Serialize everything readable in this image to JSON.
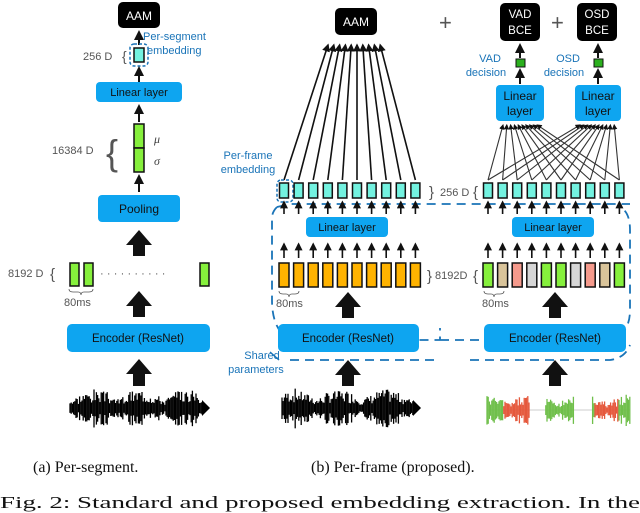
{
  "colors": {
    "accent_blue": "#0ea5f0",
    "annotation_blue": "#1a74b8",
    "loss_box": "#000000",
    "embedding_cyan": "#73f2e0",
    "feature_green": "#86f03c",
    "feature_orange": "#ffb300",
    "feature_tan": "#d9c49a",
    "feature_pink": "#f59a8c",
    "feature_gray": "#d6d6d6",
    "decision_green": "#2bb01e",
    "wave_green": "#6fbf4a",
    "wave_red": "#e5583c"
  },
  "panel_a": {
    "loss_label": "AAM",
    "embedding_label_line1": "Per-segment",
    "embedding_label_line2": "embedding",
    "embedding_dim": "256 D",
    "linear_label": "Linear layer",
    "stats_dim": "16384 D",
    "mu": "μ",
    "sigma": "σ",
    "pooling_label": "Pooling",
    "feature_dim": "8192 D",
    "frame_len": "80ms",
    "encoder_label": "Encoder (ResNet)",
    "caption": "(a) Per-segment."
  },
  "panel_b": {
    "loss_label": "AAM",
    "plus1": "+",
    "plus2": "+",
    "vad_loss_line1": "VAD",
    "vad_loss_line2": "BCE",
    "osd_loss_line1": "OSD",
    "osd_loss_line2": "BCE",
    "vad_decision_line1": "VAD",
    "vad_decision_line2": "decision",
    "osd_decision_line1": "OSD",
    "osd_decision_line2": "decision",
    "linear_small_line1": "Linear",
    "linear_small_line2": "layer",
    "embedding_label_line1": "Per-frame",
    "embedding_label_line2": "embedding",
    "embedding_dim": "256 D",
    "linear_label": "Linear layer",
    "feature_dim": "8192D",
    "frame_len": "80ms",
    "encoder_label": "Encoder (ResNet)",
    "shared_line1": "Shared",
    "shared_line2": "parameters",
    "caption": "(b) Per-frame (proposed).",
    "right_feature_colors": [
      "green",
      "tan",
      "pink",
      "gray",
      "green",
      "green",
      "gray",
      "pink",
      "tan",
      "green"
    ]
  },
  "figure_caption": "Fig. 2: Standard and proposed embedding extraction. In the"
}
